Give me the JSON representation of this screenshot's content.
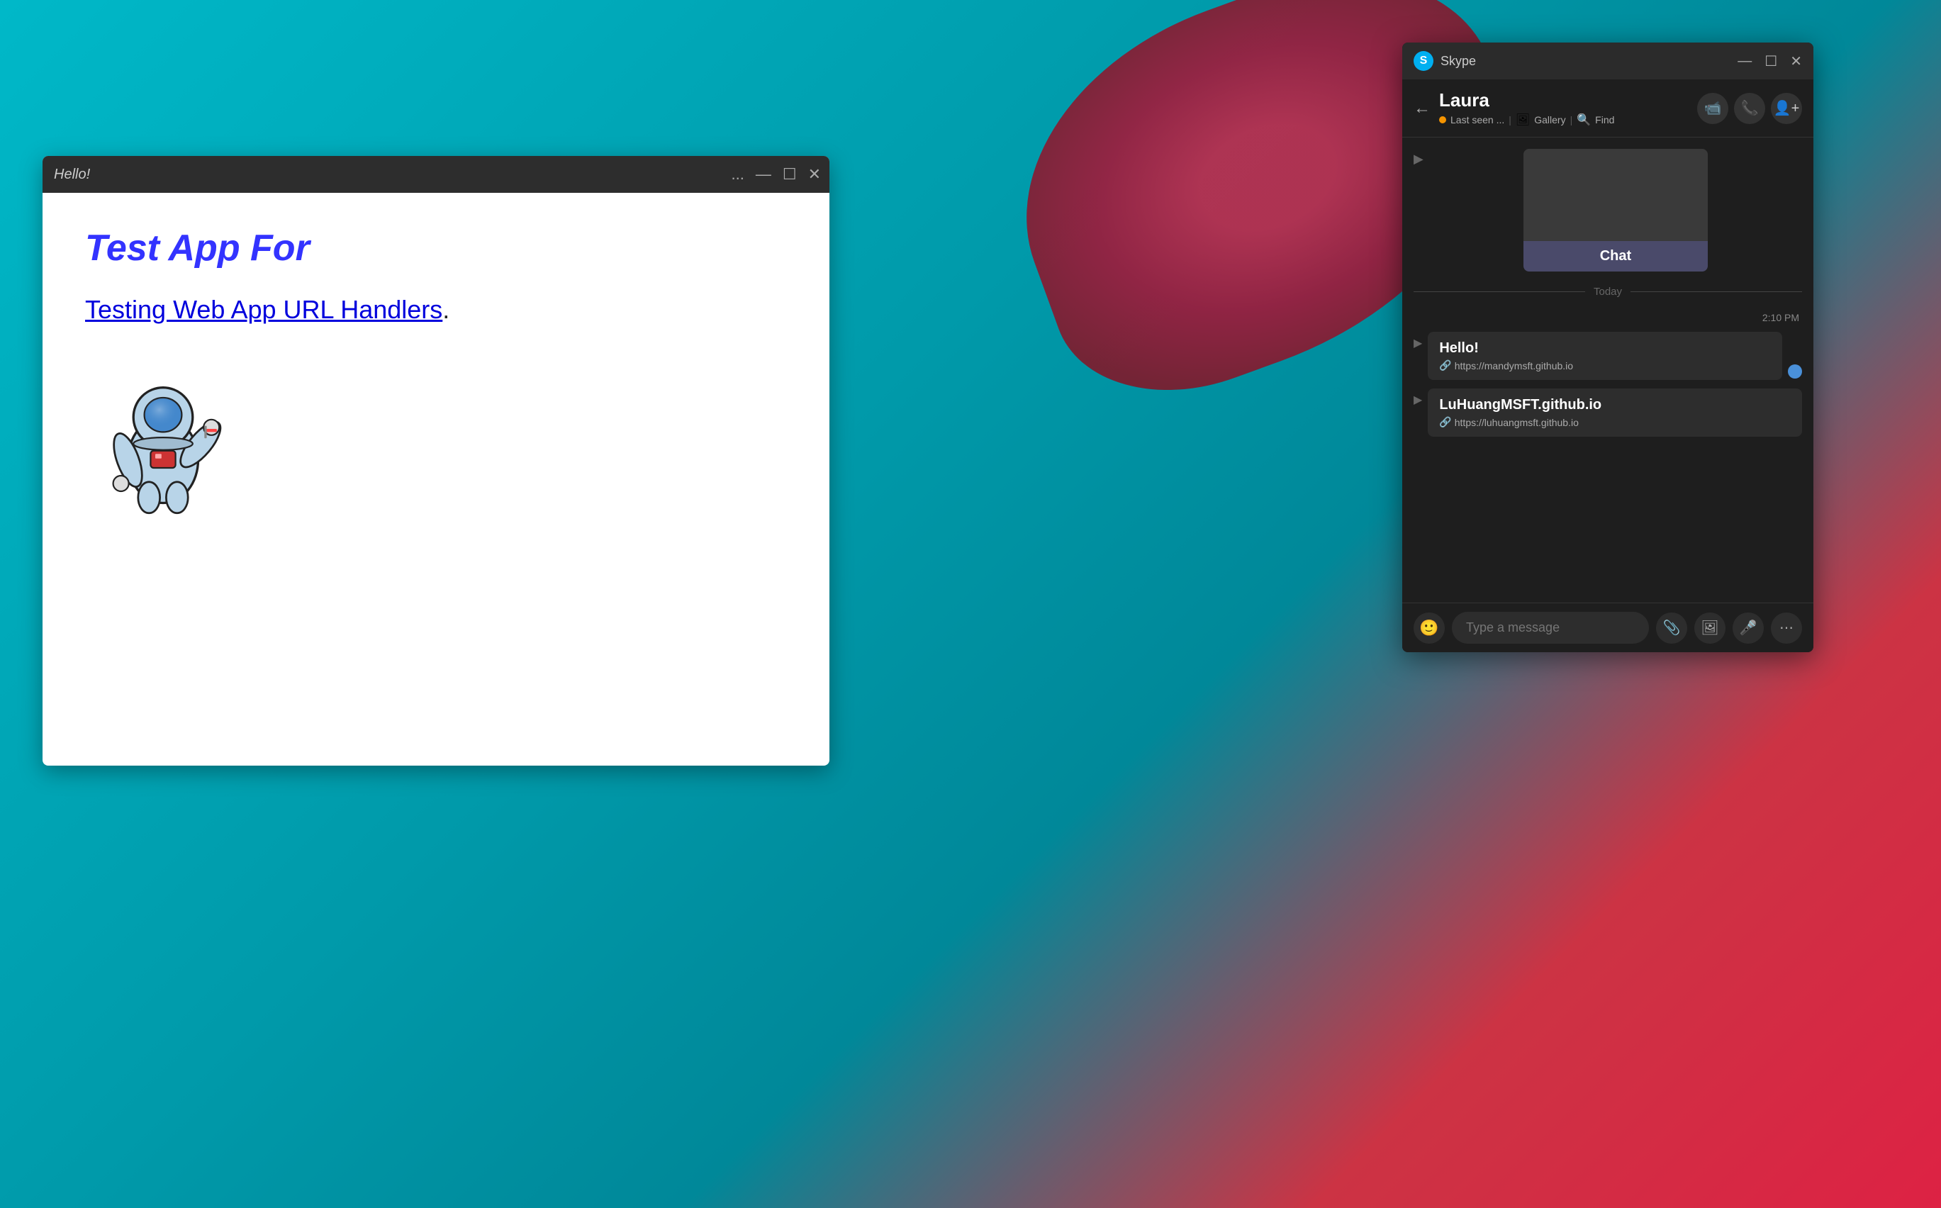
{
  "desktop": {
    "background_colors": [
      "#00b8c8",
      "#cc3344"
    ]
  },
  "webapp": {
    "window_title": "Hello!",
    "more_options": "...",
    "minimize": "—",
    "maximize": "☐",
    "close": "✕",
    "heading": "Test App For",
    "link_label": "Testing Web App URL Handlers",
    "link_period": "."
  },
  "skype": {
    "app_title": "Skype",
    "logo_letter": "S",
    "window_controls": {
      "minimize": "—",
      "maximize": "☐",
      "close": "✕"
    },
    "header": {
      "back_arrow": "←",
      "contact_name": "Laura",
      "status_text": "Last seen ...",
      "gallery_label": "Gallery",
      "find_label": "Find"
    },
    "chat_card": {
      "label": "Chat"
    },
    "messages": {
      "today_label": "Today",
      "time_label": "2:10 PM",
      "msg1_title": "Hello!",
      "msg1_link": "https://mandymsft.github.io",
      "msg2_title": "LuHuangMSFT.github.io",
      "msg2_link": "https://luhuangmsft.github.io"
    },
    "input": {
      "placeholder": "Type a message"
    }
  }
}
